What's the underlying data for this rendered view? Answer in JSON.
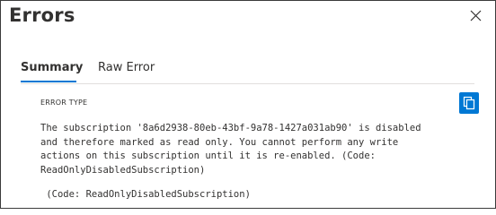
{
  "panel": {
    "title": "Errors"
  },
  "tabs": [
    {
      "label": "Summary",
      "selected": true
    },
    {
      "label": "Raw Error",
      "selected": false
    }
  ],
  "summary": {
    "error_type_label": "ERROR TYPE",
    "message": "The subscription '8a6d2938-80eb-43bf-9a78-1427a031ab90' is disabled\nand therefore marked as read only. You cannot perform any write\nactions on this subscription until it is re-enabled. (Code:\nReadOnlyDisabledSubscription)",
    "code_line": " (Code: ReadOnlyDisabledSubscription)"
  },
  "icons": {
    "close": "close-icon",
    "copy": "copy-icon"
  },
  "colors": {
    "accent": "#0078d4",
    "text": "#323130",
    "divider": "#e1dfdd"
  }
}
